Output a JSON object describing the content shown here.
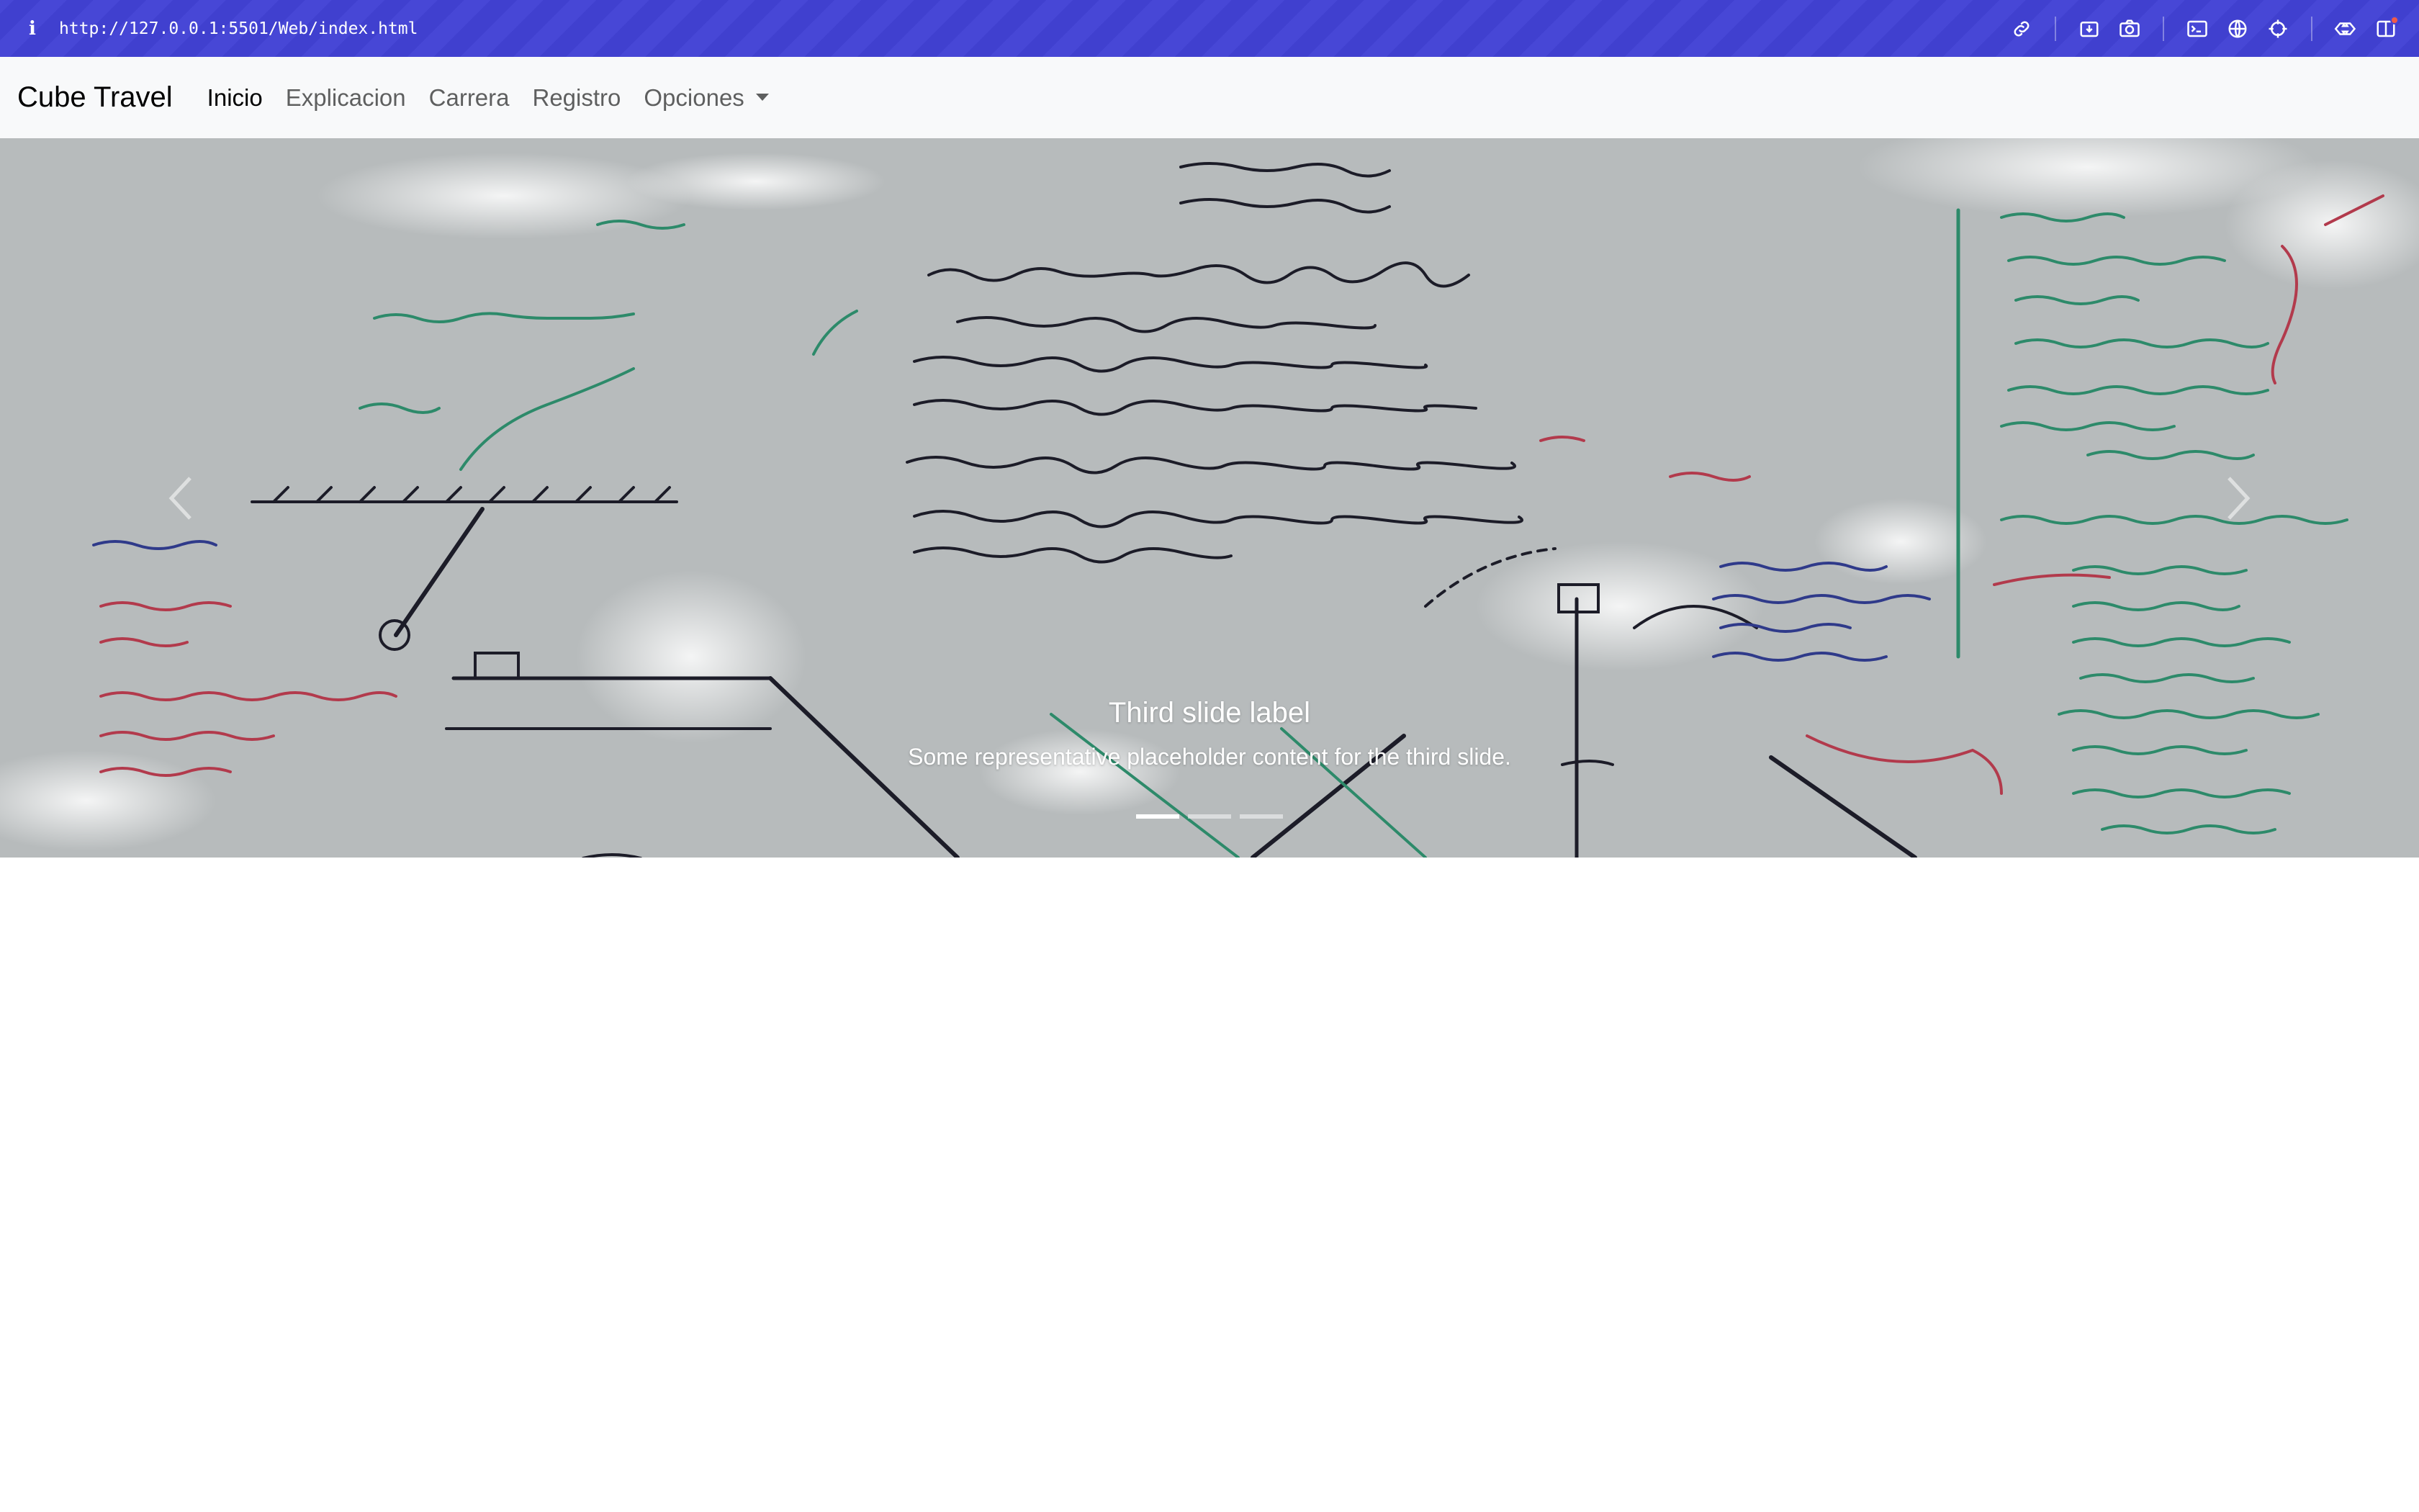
{
  "browser": {
    "info_glyph": "i",
    "url": "http://127.0.0.1:5501/Web/index.html",
    "tools": [
      "link-icon",
      "download-icon",
      "camera-icon",
      "terminal-icon",
      "globe-icon",
      "crosshair-icon",
      "extensions-icon",
      "sidebar-icon"
    ]
  },
  "navbar": {
    "brand": "Cube Travel",
    "items": [
      {
        "label": "Inicio",
        "active": true
      },
      {
        "label": "Explicacion",
        "active": false
      },
      {
        "label": "Carrera",
        "active": false
      },
      {
        "label": "Registro",
        "active": false
      },
      {
        "label": "Opciones",
        "active": false,
        "dropdown": true
      }
    ]
  },
  "carousel": {
    "caption_title": "Third slide label",
    "caption_text": "Some representative placeholder content for the third slide.",
    "indicator_count": 3,
    "active_indicator": 1,
    "prev_icon": "chevron-left-icon",
    "next_icon": "chevron-right-icon"
  },
  "colors": {
    "chrome": "#4343d2",
    "navbar_bg": "#f8f9fa",
    "board": "#b8bcbd",
    "ink_black": "#1c1c28",
    "ink_green": "#2d8a6a",
    "ink_red": "#b23a4c",
    "ink_blue": "#2f3a8a"
  }
}
